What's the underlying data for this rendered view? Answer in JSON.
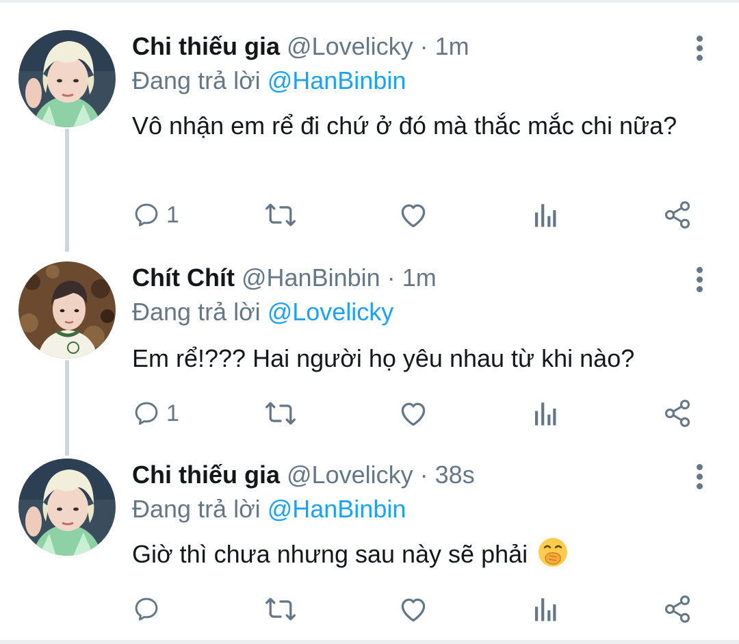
{
  "tweets": [
    {
      "name": "Chi thiếu gia",
      "handle": "@Lovelicky",
      "separator": "·",
      "time": "1m",
      "replying_prefix": "Đang trả lời",
      "replying_to": "@HanBinbin",
      "text": "Vô nhận em rể đi chứ ở đó mà thắc mắc chi nữa?",
      "reply_count": "1",
      "avatar": "blond-hair-avatar"
    },
    {
      "name": "Chít Chít",
      "handle": "@HanBinbin",
      "separator": "·",
      "time": "1m",
      "replying_prefix": "Đang trả lời",
      "replying_to": "@Lovelicky",
      "text": "Em rể!??? Hai người họ yêu nhau từ khi nào?",
      "reply_count": "1",
      "avatar": "dark-hair-avatar"
    },
    {
      "name": "Chi thiếu gia",
      "handle": "@Lovelicky",
      "separator": "·",
      "time": "38s",
      "replying_prefix": "Đang trả lời",
      "replying_to": "@HanBinbin",
      "text": "Giờ thì chưa nhưng sau này sẽ phải",
      "emoji": "face-with-hand-over-mouth-emoji",
      "reply_count": "",
      "avatar": "blond-hair-avatar"
    }
  ],
  "colors": {
    "text": "#14171a",
    "muted": "#657786",
    "link": "#1da1f2",
    "thread_line": "#ccd6dd"
  },
  "icons": [
    "reply-icon",
    "retweet-icon",
    "like-icon",
    "analytics-icon",
    "share-icon",
    "more-options-icon"
  ]
}
